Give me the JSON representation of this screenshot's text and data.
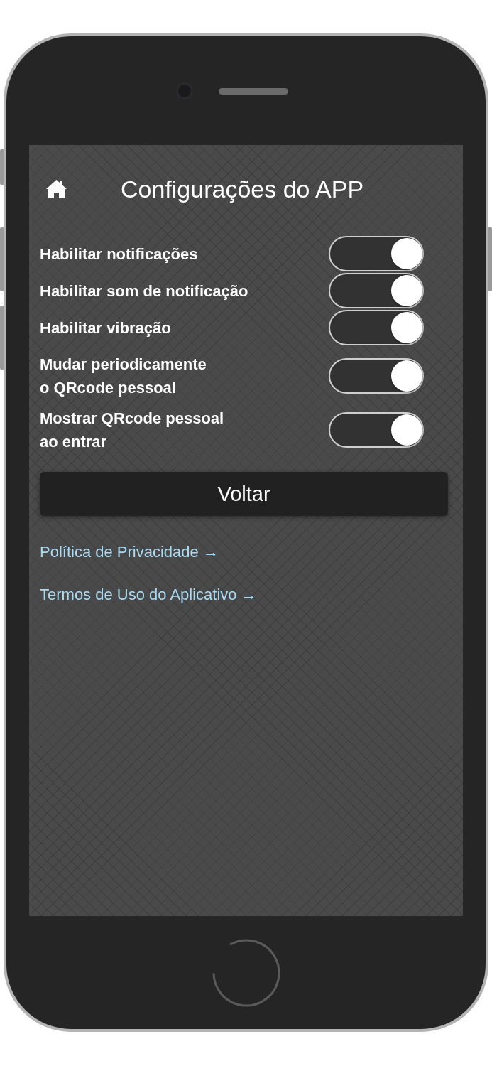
{
  "header": {
    "title": "Configurações do APP"
  },
  "settings": [
    {
      "label": "Habilitar notificações",
      "on": true
    },
    {
      "label": "Habilitar som de notificação",
      "on": true
    },
    {
      "label": "Habilitar vibração",
      "on": true
    },
    {
      "label": "Mudar periodicamente\no QRcode pessoal",
      "on": true
    },
    {
      "label": "Mostrar QRcode pessoal\nao entrar",
      "on": true
    }
  ],
  "back_button": "Voltar",
  "links": [
    "Política de Privacidade →",
    "Termos de Uso do Aplicativo →"
  ]
}
